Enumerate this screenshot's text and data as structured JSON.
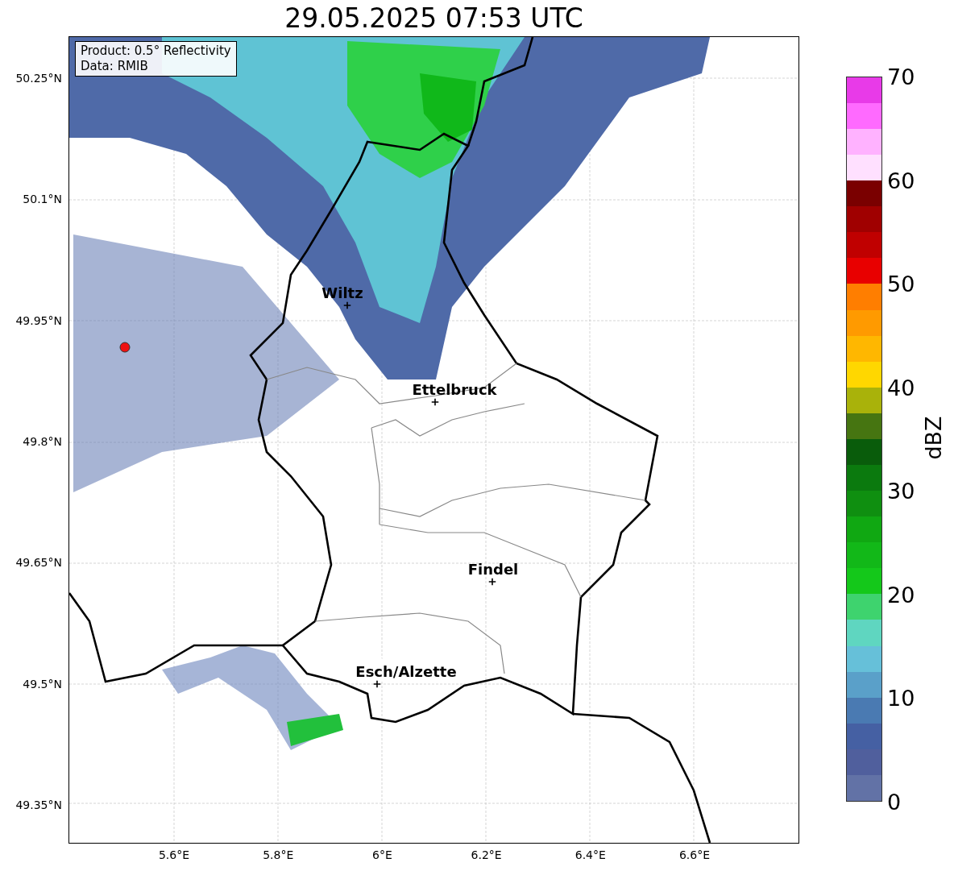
{
  "title": "29.05.2025 07:53 UTC",
  "info_box": [
    "Product: 0.5° Reflectivity",
    "Data: RMIB"
  ],
  "lat_ticks": [
    "50.25°N",
    "50.1°N",
    "49.95°N",
    "49.8°N",
    "49.65°N",
    "49.5°N",
    "49.35°N"
  ],
  "lon_ticks": [
    "5.6°E",
    "5.8°E",
    "6°E",
    "6.2°E",
    "6.4°E",
    "6.6°E"
  ],
  "cities": [
    {
      "name": "Wiltz"
    },
    {
      "name": "Ettelbruck"
    },
    {
      "name": "Findel"
    },
    {
      "name": "Esch/Alzette"
    }
  ],
  "colorbar": {
    "label": "dBZ",
    "ticks": [
      "70",
      "60",
      "50",
      "40",
      "30",
      "20",
      "10",
      "0"
    ],
    "segments": [
      {
        "color": "#6272a6"
      },
      {
        "color": "#505f9d"
      },
      {
        "color": "#4560a3"
      },
      {
        "color": "#4a7ab2"
      },
      {
        "color": "#5aa0c9"
      },
      {
        "color": "#66c0d9"
      },
      {
        "color": "#5fd6c0"
      },
      {
        "color": "#3ed36e"
      },
      {
        "color": "#14c81a"
      },
      {
        "color": "#12b818"
      },
      {
        "color": "#10a812"
      },
      {
        "color": "#0f8f10"
      },
      {
        "color": "#0b7a0e"
      },
      {
        "color": "#095c0b"
      },
      {
        "color": "#467511"
      },
      {
        "color": "#a9b20a"
      },
      {
        "color": "#ffd700"
      },
      {
        "color": "#ffb700"
      },
      {
        "color": "#ff9a00"
      },
      {
        "color": "#ff7e00"
      },
      {
        "color": "#e80000"
      },
      {
        "color": "#c00000"
      },
      {
        "color": "#a00000"
      },
      {
        "color": "#7a0000"
      },
      {
        "color": "#ffe0ff"
      },
      {
        "color": "#ffb2ff"
      },
      {
        "color": "#ff6aff"
      },
      {
        "color": "#e83ae8"
      }
    ]
  }
}
